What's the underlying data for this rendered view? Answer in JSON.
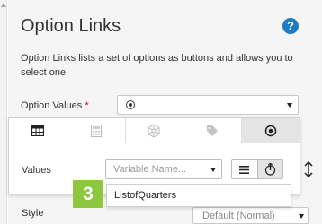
{
  "header": {
    "title": "Option Links",
    "help_glyph": "?",
    "description": "Option Links lists a set of options as buttons and allows you to select one"
  },
  "option_values": {
    "label": "Option Values",
    "required_marker": "*",
    "selected_icon": "radio-icon"
  },
  "type_tabs": [
    {
      "icon": "table-icon"
    },
    {
      "icon": "calculator-icon"
    },
    {
      "icon": "hexagon-network-icon"
    },
    {
      "icon": "tag-icon"
    },
    {
      "icon": "radio-icon",
      "active": true
    }
  ],
  "values_row": {
    "label": "Values",
    "placeholder": "Variable Name...",
    "toggle_list_icon": "list-icon",
    "toggle_variable_icon": "variable-picker-icon",
    "sort_icon": "sort-icon"
  },
  "dropdown": {
    "items": [
      "ListofQuarters"
    ]
  },
  "step_badge": "3",
  "style": {
    "label": "Style",
    "value": "Default (Normal)"
  },
  "colors": {
    "accent_blue": "#1f7bc1",
    "badge_green": "#8dc63f",
    "required_red": "#d0021b"
  }
}
